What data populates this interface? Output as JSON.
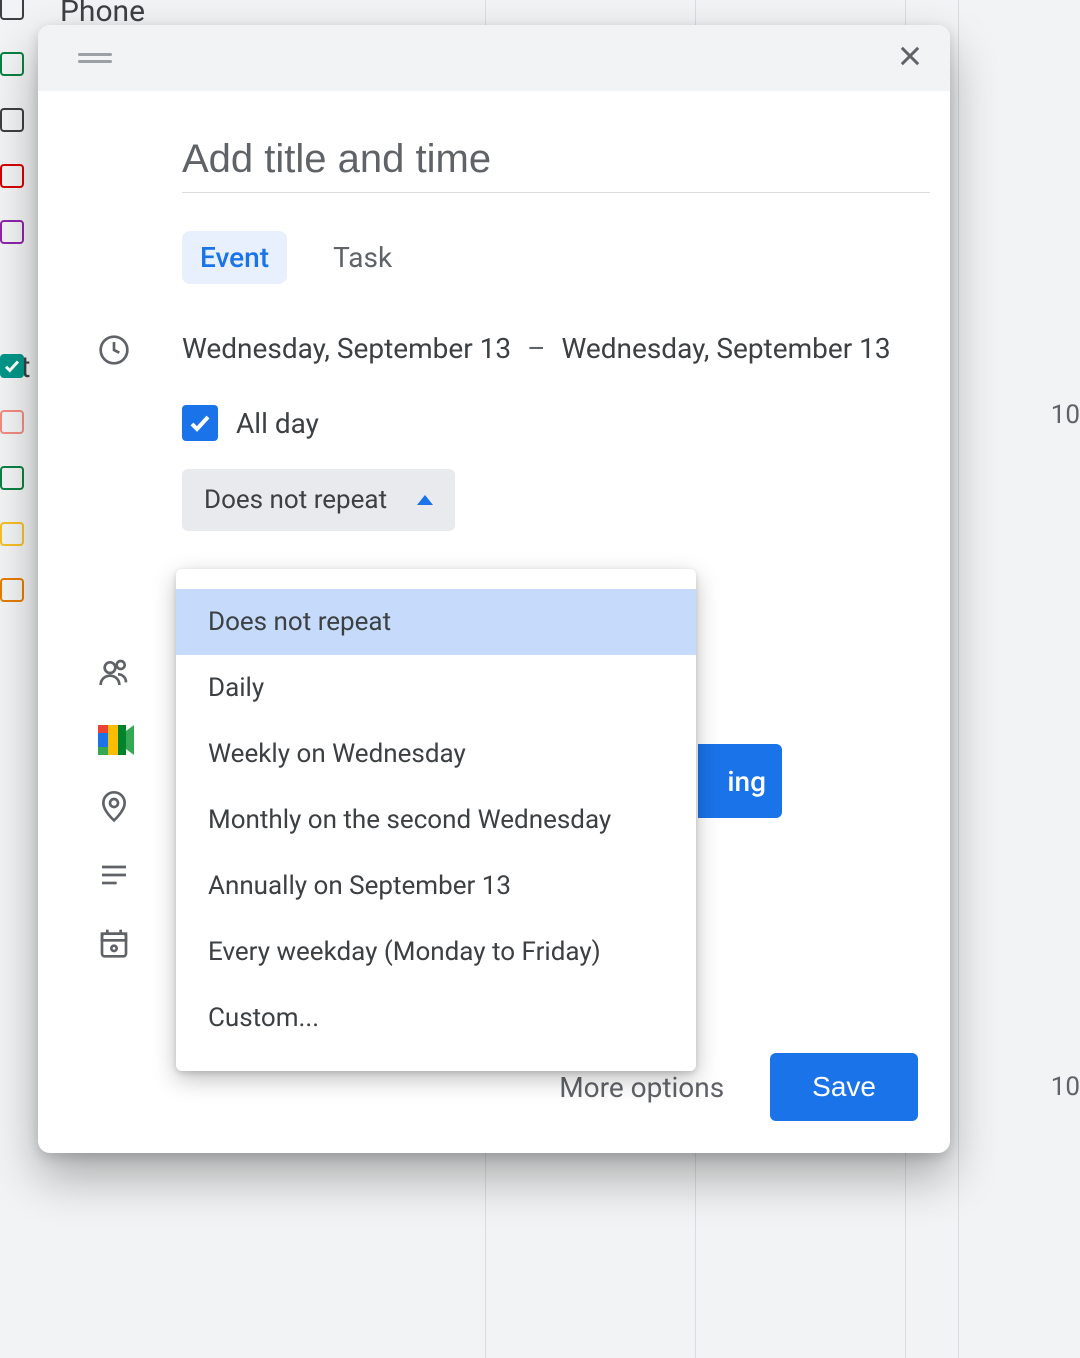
{
  "background": {
    "phone_label": "Phone",
    "ot_label": "Ot",
    "time_marks": [
      "10",
      "10"
    ],
    "calendar_swatches": [
      {
        "color": "#3c4043",
        "filled": false
      },
      {
        "color": "#0b8043",
        "filled": false
      },
      {
        "color": "#3c4043",
        "filled": false
      },
      {
        "color": "#d50000",
        "filled": false
      },
      {
        "color": "#8e24aa",
        "filled": false
      },
      {
        "color": "#009688",
        "filled": true
      },
      {
        "color": "#f28b82",
        "filled": false
      },
      {
        "color": "#0b8043",
        "filled": false
      },
      {
        "color": "#f6bf26",
        "filled": false
      },
      {
        "color": "#e67c00",
        "filled": false
      }
    ]
  },
  "dialog": {
    "title_placeholder": "Add title and time",
    "tabs": {
      "event": "Event",
      "task": "Task",
      "active": "event"
    },
    "dates": {
      "start": "Wednesday, September 13",
      "end": "Wednesday, September 13",
      "separator": "–"
    },
    "all_day": {
      "label": "All day",
      "checked": true
    },
    "repeat": {
      "selected": "Does not repeat",
      "options": [
        "Does not repeat",
        "Daily",
        "Weekly on Wednesday",
        "Monthly on the second Wednesday",
        "Annually on September 13",
        "Every weekday (Monday to Friday)",
        "Custom..."
      ]
    },
    "meet_partial": "ing",
    "footer": {
      "more_options": "More options",
      "save": "Save"
    }
  }
}
